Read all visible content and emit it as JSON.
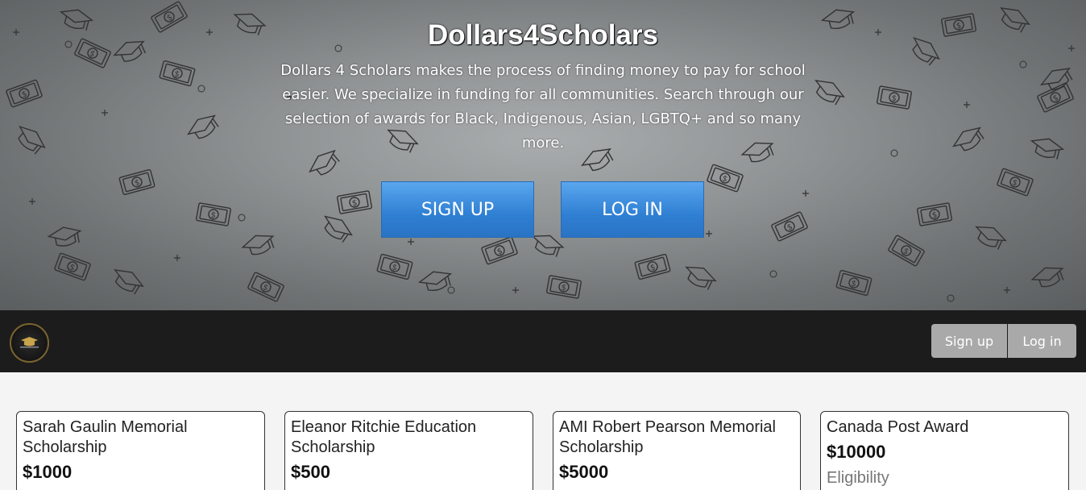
{
  "hero": {
    "title": "Dollars4Scholars",
    "description": "Dollars 4 Scholars makes the process of finding money to pay for school easier. We specialize in funding for all communities. Search through our selection of awards for Black, Indigenous, Asian, LGBTQ+ and so many more.",
    "signup_label": "SIGN UP",
    "login_label": "LOG IN"
  },
  "navbar": {
    "logo_icon": "graduation-cap-logo",
    "signup_label": "Sign up",
    "login_label": "Log in"
  },
  "scholarships": [
    {
      "title": "Sarah Gaulin Memorial Scholarship",
      "amount": "$1000",
      "eligibility": ""
    },
    {
      "title": "Eleanor Ritchie Education Scholarship",
      "amount": "$500",
      "eligibility": ""
    },
    {
      "title": "AMI Robert Pearson Memorial Scholarship",
      "amount": "$5000",
      "eligibility": ""
    },
    {
      "title": "Canada Post Award",
      "amount": "$10000",
      "eligibility": "Eligibility"
    }
  ],
  "colors": {
    "primary_button": "#3a8ee0",
    "navbar_bg": "#1c1c1c",
    "nav_button": "#a9a9a9"
  }
}
